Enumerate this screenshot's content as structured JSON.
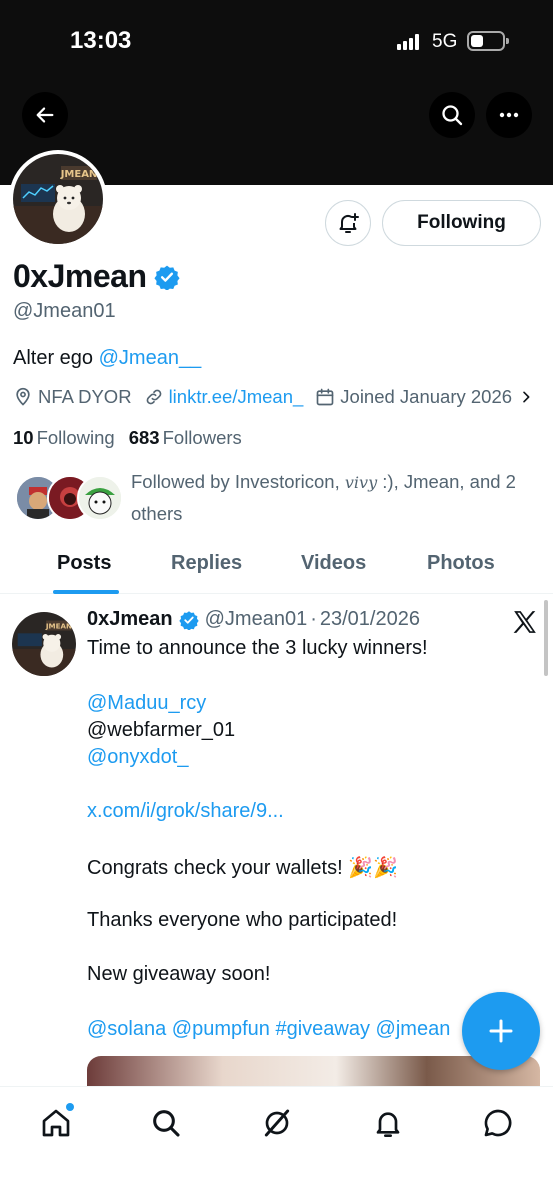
{
  "status_bar": {
    "time": "13:03",
    "network": "5G"
  },
  "profile": {
    "display_name": "0xJmean",
    "handle": "@Jmean01",
    "bio_prefix": "Alter ego ",
    "bio_mention": "@Jmean__",
    "location": "NFA DYOR",
    "website": "linktr.ee/Jmean_",
    "joined": "Joined January 2026",
    "following_count": "10",
    "following_label": "Following",
    "followers_count": "683",
    "followers_label": "Followers",
    "followed_by_prefix": "Followed by Investoricon, ",
    "followed_by_vivy": "vivy",
    "followed_by_suffix": " :), Jmean, and 2 others",
    "avatar_text": "JMEAN"
  },
  "actions": {
    "following_button": "Following"
  },
  "tabs": [
    {
      "label": "Posts"
    },
    {
      "label": "Replies"
    },
    {
      "label": "Videos"
    },
    {
      "label": "Photos"
    }
  ],
  "tweet": {
    "author": "0xJmean",
    "handle": "@Jmean01",
    "separator": "·",
    "date": "23/01/2026",
    "line1": "Time to announce the 3 lucky winners!",
    "winner1": "@Maduu_rcy",
    "winner2": "@webfarmer_01",
    "winner3": "@onyxdot_",
    "link": "x.com/i/grok/share/9...",
    "congrats": "Congrats check your wallets! ",
    "congrats_emoji": "🎉🎉",
    "thanks": "Thanks everyone who participated!",
    "new_giveaway": "New giveaway soon!",
    "tags": "@solana @pumpfun #giveaway @jmean"
  },
  "colors": {
    "accent": "#1d9bf0",
    "verified": "#1d9bf0",
    "muted": "#536471"
  }
}
